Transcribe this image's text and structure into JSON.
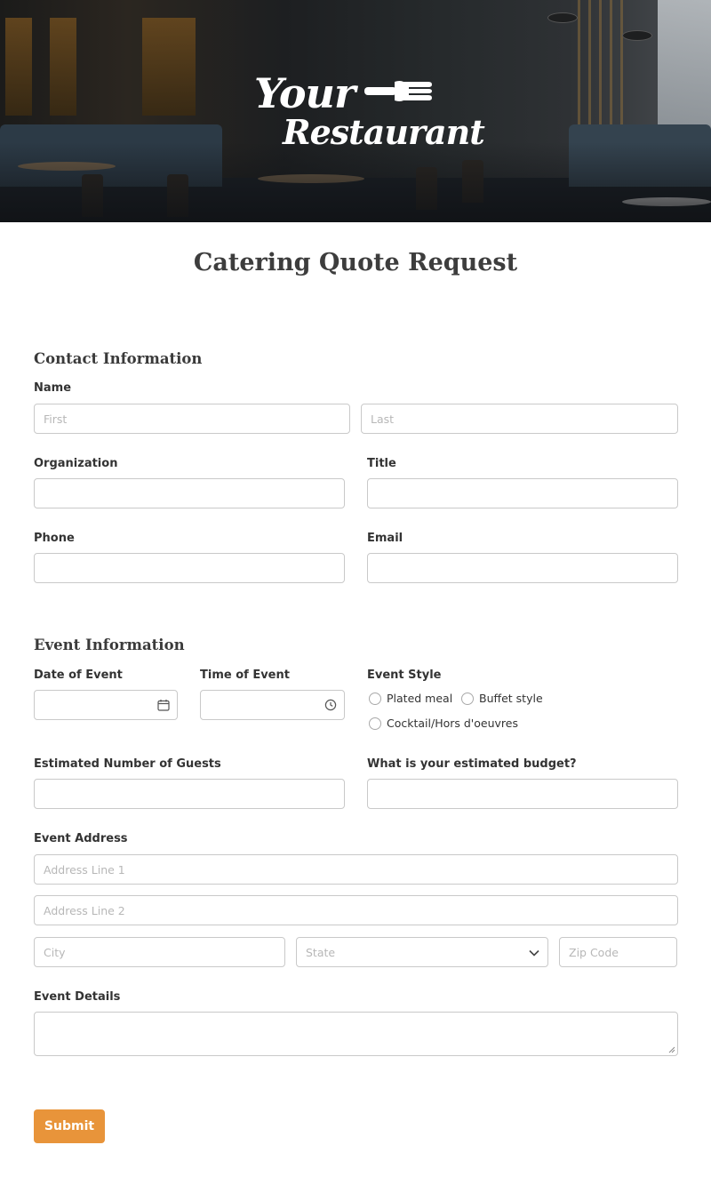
{
  "header": {
    "logo_line1": "Your",
    "logo_line2": "Restaurant"
  },
  "form": {
    "title": "Catering Quote Request",
    "contact_section": "Contact Information",
    "name_label": "Name",
    "first_placeholder": "First",
    "last_placeholder": "Last",
    "organization_label": "Organization",
    "title_label": "Title",
    "phone_label": "Phone",
    "email_label": "Email",
    "event_section": "Event Information",
    "date_label": "Date of Event",
    "time_label": "Time of Event",
    "event_style_label": "Event Style",
    "event_style_options": [
      "Plated meal",
      "Buffet style",
      "Cocktail/Hors d'oeuvres"
    ],
    "guests_label": "Estimated Number of Guests",
    "budget_label": "What is your estimated budget?",
    "address_label": "Event Address",
    "address1_placeholder": "Address Line 1",
    "address2_placeholder": "Address Line 2",
    "city_placeholder": "City",
    "state_placeholder": "State",
    "zip_placeholder": "Zip Code",
    "details_label": "Event Details",
    "submit_label": "Submit"
  },
  "colors": {
    "accent": "#e8943a",
    "border": "#c9c9c9",
    "text": "#333333"
  },
  "icons": [
    "calendar-icon",
    "clock-icon",
    "chevron-down-icon",
    "fork-icon"
  ]
}
